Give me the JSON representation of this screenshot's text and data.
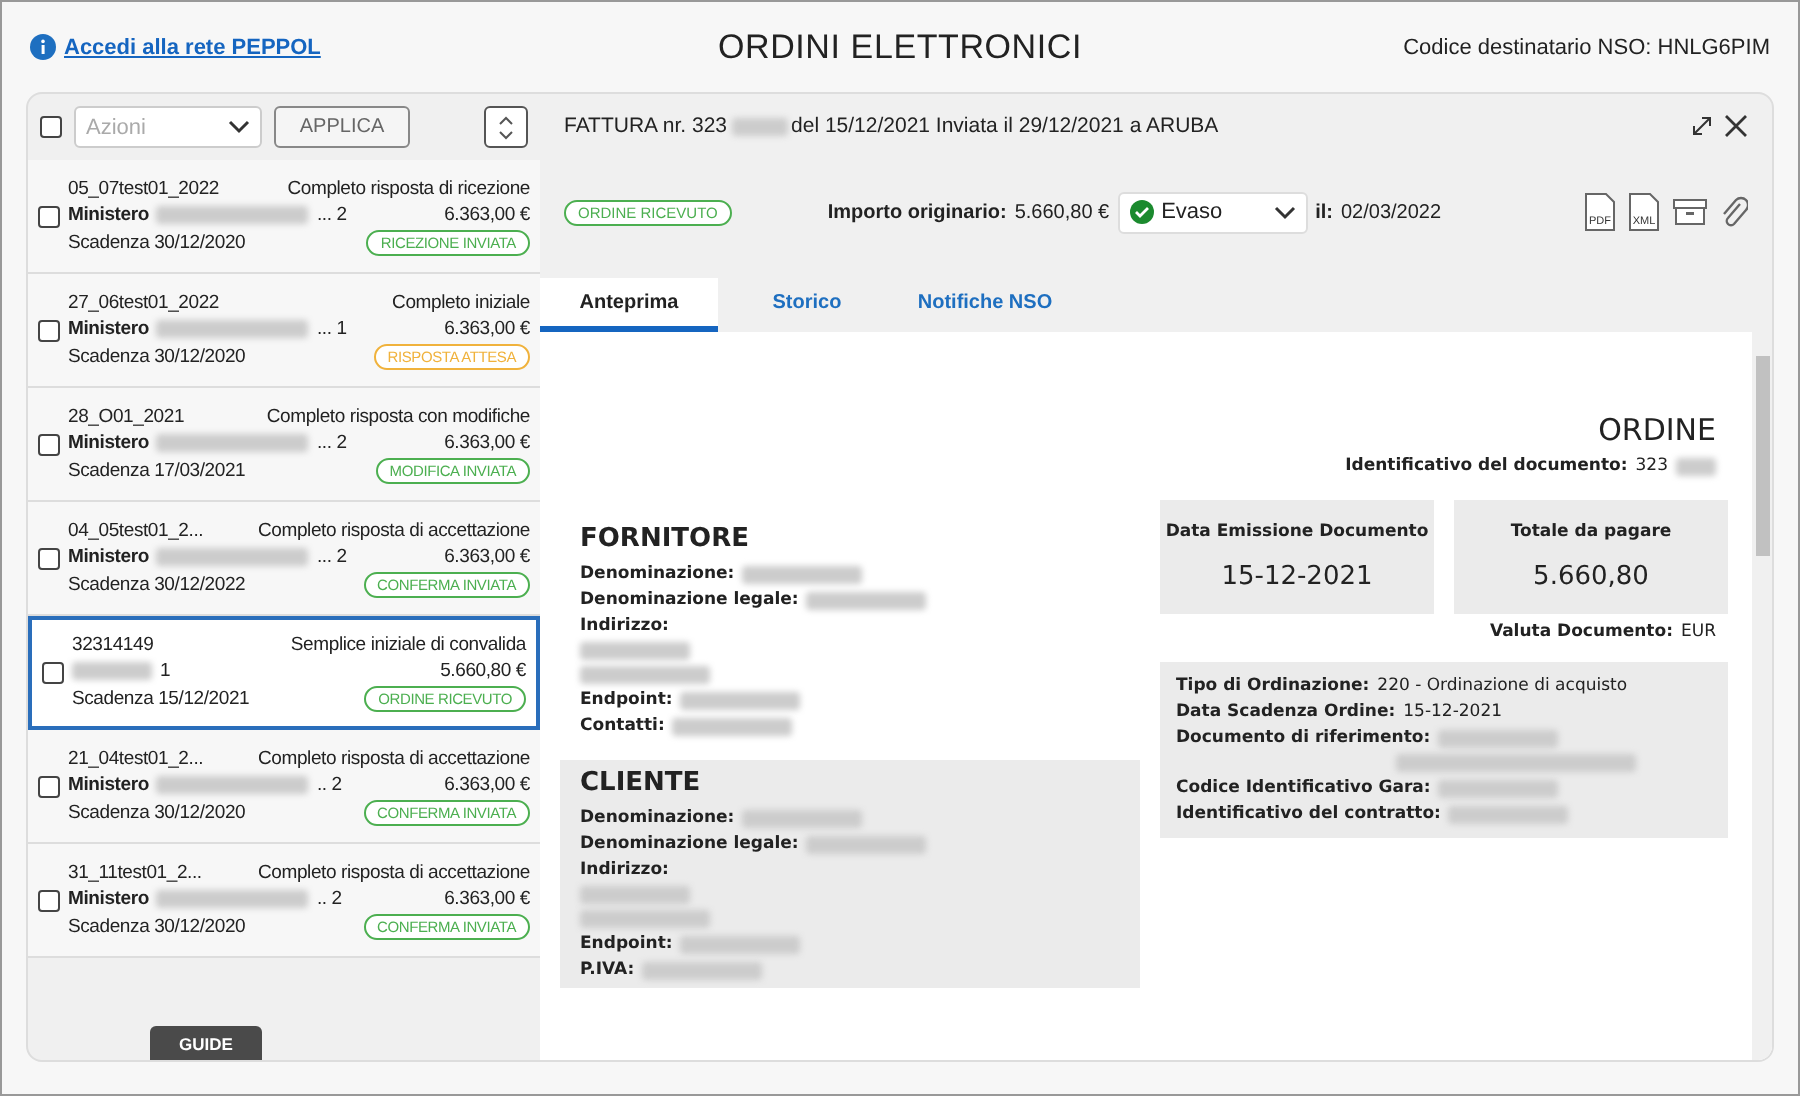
{
  "header": {
    "link": "Accedi alla rete PEPPOL",
    "title": "ORDINI ELETTRONICI",
    "recipient": "Codice destinatario NSO: HNLG6PIM"
  },
  "toolbar": {
    "checked": false,
    "placeholder": "Azioni",
    "apply": "APPLICA"
  },
  "orders": [
    {
      "code": "05_07test01_2022",
      "type": "Completo risposta di ricezione",
      "name": "Ministero",
      "suffix": "... 2",
      "amount": "6.363,00 €",
      "due": "Scadenza 30/12/2020",
      "badge": "RICEZIONE INVIATA",
      "color": "#4caf50",
      "checked": false,
      "selected": false
    },
    {
      "code": "27_06test01_2022",
      "type": "Completo iniziale",
      "name": "Ministero",
      "suffix": "... 1",
      "amount": "6.363,00 €",
      "due": "Scadenza 30/12/2020",
      "badge": "RISPOSTA ATTESA",
      "color": "#f0b23c",
      "checked": false,
      "selected": false
    },
    {
      "code": "28_O01_2021",
      "type": "Completo risposta con modifiche",
      "name": "Ministero",
      "suffix": "... 2",
      "amount": "6.363,00 €",
      "due": "Scadenza 17/03/2021",
      "badge": "MODIFICA INVIATA",
      "color": "#4caf50",
      "checked": false,
      "selected": false
    },
    {
      "code": "04_05test01_2...",
      "type": "Completo risposta di accettazione",
      "name": "Ministero",
      "suffix": "... 2",
      "amount": "6.363,00 €",
      "due": "Scadenza 30/12/2022",
      "badge": "CONFERMA INVIATA",
      "color": "#4caf50",
      "checked": false,
      "selected": false
    },
    {
      "code": "32314149",
      "type": "Semplice iniziale di convalida",
      "suffix": "1",
      "amount": "5.660,80 €",
      "due": "Scadenza 15/12/2021",
      "badge": "ORDINE RICEVUTO",
      "color": "#4caf50",
      "checked": false,
      "selected": true
    },
    {
      "code": "21_04test01_2...",
      "type": "Completo risposta di accettazione",
      "name": "Ministero",
      "suffix": ".. 2",
      "amount": "6.363,00 €",
      "due": "Scadenza 30/12/2020",
      "badge": "CONFERMA INVIATA",
      "color": "#4caf50",
      "checked": false,
      "selected": false
    },
    {
      "code": "31_11test01_2...",
      "type": "Completo risposta di accettazione",
      "name": "Ministero",
      "suffix": ".. 2",
      "amount": "6.363,00 €",
      "due": "Scadenza 30/12/2020",
      "badge": "CONFERMA INVIATA",
      "color": "#4caf50",
      "checked": false,
      "selected": false
    }
  ],
  "detail": {
    "title_prefix": "FATTURA nr. 323",
    "title_suffix": "del 15/12/2021 Inviata il 29/12/2021 a ARUBA",
    "badge": "ORDINE RICEVUTO",
    "color": "#4caf50",
    "amount_label": "Importo originario:",
    "amount": "5.660,80 €",
    "status": "Evaso",
    "date_label": "il:",
    "date": "02/03/2022",
    "file_icons": [
      "PDF",
      "XML"
    ],
    "tabs": [
      {
        "label": "Anteprima",
        "selected": true
      },
      {
        "label": "Storico",
        "selected": false
      },
      {
        "label": "Notifiche NSO",
        "selected": false
      }
    ]
  },
  "document": {
    "heading": "ORDINE",
    "id_label": "Identificativo del documento:",
    "id_value": "323",
    "supplier": {
      "title": "FORNITORE",
      "fields": [
        {
          "label": "Denominazione:"
        },
        {
          "label": "Denominazione legale:"
        },
        {
          "label": "Indirizzo:",
          "kind": "address"
        },
        {
          "label": "Endpoint:"
        },
        {
          "label": "Contatti:"
        }
      ]
    },
    "cards": [
      {
        "label": "Data Emissione Documento",
        "value": "15-12-2021"
      },
      {
        "label": "Totale da pagare",
        "value": "5.660,80"
      }
    ],
    "currency_label": "Valuta Documento:",
    "currency": "EUR",
    "info": [
      {
        "label": "Tipo di Ordinazione:",
        "value": "220 - Ordinazione di acquisto"
      },
      {
        "label": "Data Scadenza Ordine:",
        "value": "15-12-2021"
      },
      {
        "label": "Documento di riferimento:",
        "kind": "double"
      },
      {
        "label": "Codice Identificativo Gara:"
      },
      {
        "label": "Identificativo del contratto:"
      }
    ],
    "client": {
      "title": "CLIENTE",
      "fields": [
        {
          "label": "Denominazione:"
        },
        {
          "label": "Denominazione legale:"
        },
        {
          "label": "Indirizzo:",
          "kind": "address"
        },
        {
          "label": "Endpoint:"
        },
        {
          "label": "P.IVA:"
        }
      ]
    }
  },
  "footer": {
    "guide": "GUIDE"
  }
}
